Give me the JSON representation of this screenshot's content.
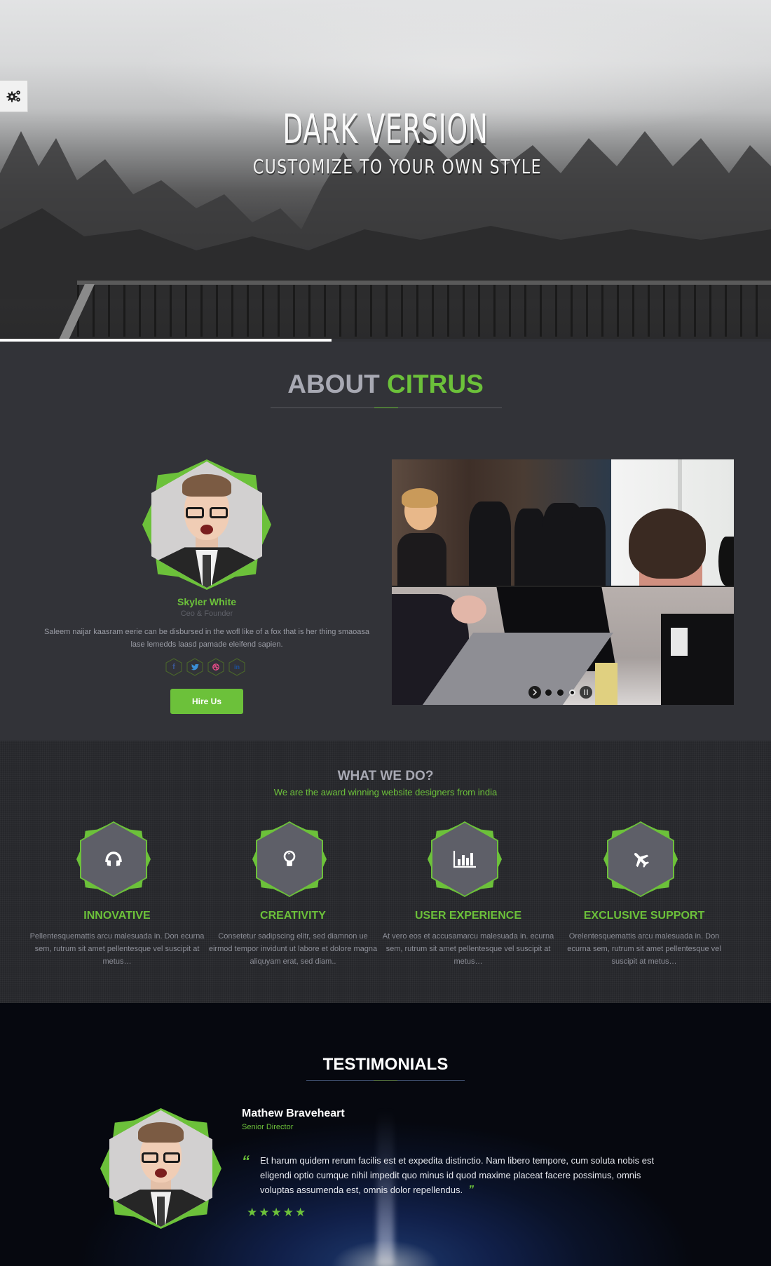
{
  "theme": {
    "accent": "#6cc13a",
    "bg_dark": "#323338",
    "bg_services": "#26272b",
    "bg_testimonials": "#06080f"
  },
  "hero": {
    "title": "DARK VERSION",
    "subtitle": "CUSTOMIZE TO YOUR OWN STYLE",
    "settings_icon": "gears-icon",
    "slide_progress": 0.43
  },
  "about": {
    "title_plain": "ABOUT ",
    "title_highlight": "CITRUS",
    "member": {
      "name": "Skyler White",
      "role": "Ceo & Founder",
      "bio": "Saleem naijar kaasram eerie can be disbursed in the wofl like of a fox that is her thing smaoasa lase lemedds laasd pamade eleifend sapien."
    },
    "socials": [
      {
        "name": "facebook",
        "glyph": "f",
        "color": "#3b5998"
      },
      {
        "name": "twitter",
        "glyph": "t",
        "color": "#3a8fd6"
      },
      {
        "name": "dribbble",
        "glyph": "d",
        "color": "#ea4c89"
      },
      {
        "name": "linkedin",
        "glyph": "in",
        "color": "#1c4f9a"
      }
    ],
    "hire_label": "Hire Us",
    "slider": {
      "slide_count": 3,
      "active_slide": 3,
      "next_icon": "chevron-right-icon",
      "pause_icon": "pause-icon"
    }
  },
  "services": {
    "title": "WHAT WE DO?",
    "subtitle": "We are the award winning website designers from india",
    "items": [
      {
        "icon": "headphones-icon",
        "name": "INNOVATIVE",
        "desc": "Pellentesquemattis arcu malesuada in. Don ecurna sem, rutrum sit amet pellentesque vel suscipit at metus…"
      },
      {
        "icon": "lightbulb-icon",
        "name": "CREATIVITY",
        "desc": "Consetetur sadipscing elitr, sed diamnon ue eirmod tempor invidunt ut labore et dolore magna aliquyam erat, sed diam.."
      },
      {
        "icon": "bar-chart-icon",
        "name": "USER EXPERIENCE",
        "desc": "At vero eos et accusamarcu malesuada in. ecurna sem, rutrum sit amet pellentesque vel suscipit at metus…"
      },
      {
        "icon": "airplane-icon",
        "name": "EXCLUSIVE SUPPORT",
        "desc": "Orelentesquemattis arcu malesuada in. Don ecurna sem, rutrum sit amet pellentesque vel suscipit at metus…"
      }
    ]
  },
  "testimonials": {
    "title": "TESTIMONIALS",
    "name": "Mathew Braveheart",
    "role": "Senior Director",
    "quote_open": "“",
    "quote": "Et harum quidem rerum facilis est et expedita distinctio. Nam libero tempore, cum soluta nobis est eligendi optio cumque nihil impedit quo minus id quod maxime placeat facere possimus, omnis voluptas assumenda est, omnis dolor repellendus.",
    "quote_close": "”",
    "rating": 5,
    "rating_max": 5
  }
}
